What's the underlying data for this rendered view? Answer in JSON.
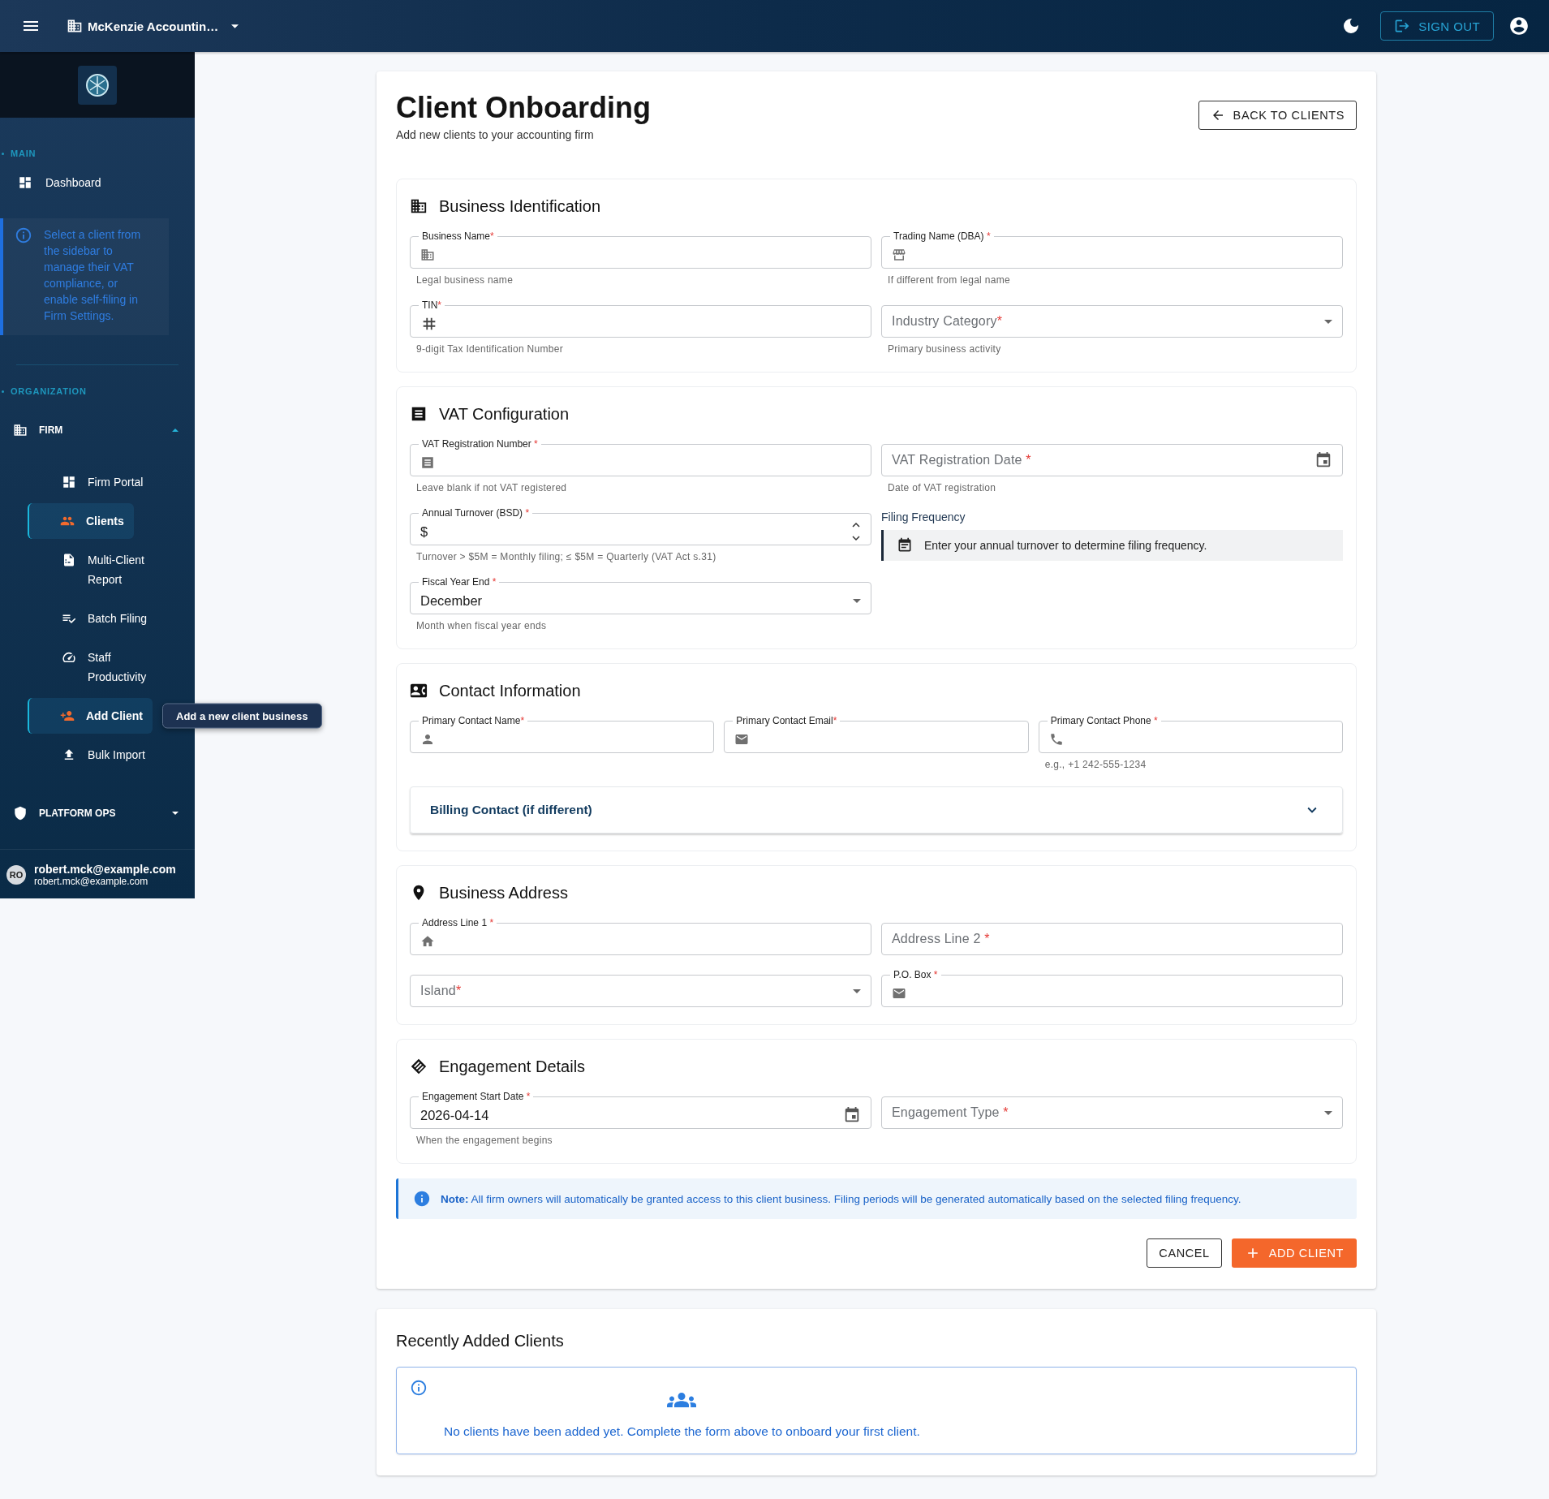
{
  "topbar": {
    "org_name": "McKenzie Accountin…",
    "sign_out": "SIGN OUT"
  },
  "sidebar": {
    "main_heading": "MAIN",
    "dashboard": "Dashboard",
    "notice": "Select a client from the sidebar to manage their VAT compliance, or enable self-filing in Firm Settings.",
    "org_heading": "ORGANIZATION",
    "groups": [
      {
        "label": "FIRM",
        "expanded": true,
        "children": [
          {
            "label": "Firm Portal",
            "selected": false
          },
          {
            "label": "Clients",
            "selected": true
          },
          {
            "label": "Multi-Client Report",
            "selected": false
          },
          {
            "label": "Batch Filing",
            "selected": false
          },
          {
            "label": "Staff Productivity",
            "selected": false
          },
          {
            "label": "Add Client",
            "selected": true,
            "tooltip": "Add a new client business"
          },
          {
            "label": "Bulk Import",
            "selected": false
          }
        ]
      },
      {
        "label": "PLATFORM OPS",
        "expanded": false
      }
    ],
    "user": {
      "initials": "RO",
      "name": "robert.mck@example.com",
      "email": "robert.mck@example.com"
    }
  },
  "page": {
    "title": "Client Onboarding",
    "subtitle": "Add new clients to your accounting firm",
    "back_button": "BACK TO CLIENTS"
  },
  "sections": [
    {
      "title": "Business Identification",
      "rows": [
        [
          {
            "kind": "text",
            "label": "Business Name",
            "mark": "*",
            "floated": true,
            "helper": "Legal business name"
          },
          {
            "kind": "text",
            "label": "Trading Name (DBA)",
            "mark": " *",
            "floated": true,
            "helper": "If different from legal name"
          }
        ],
        [
          {
            "kind": "text",
            "label": "TIN",
            "mark": "*",
            "floated": true,
            "helper": "9-digit Tax Identification Number"
          },
          {
            "kind": "select",
            "label": "Industry Category",
            "mark": "*",
            "floated": false,
            "helper": "Primary business activity"
          }
        ]
      ]
    },
    {
      "title": "VAT Configuration",
      "rows": [
        [
          {
            "kind": "text",
            "label": "VAT Registration Number",
            "mark": " *",
            "floated": true,
            "helper": "Leave blank if not VAT registered"
          },
          {
            "kind": "date",
            "label": "VAT Registration Date",
            "mark": " *",
            "floated": false,
            "helper": "Date of VAT registration"
          }
        ],
        [
          {
            "kind": "number",
            "label": "Annual Turnover (BSD)",
            "mark": " *",
            "floated": true,
            "prefix": "$",
            "helper": "Turnover > $5M = Monthly filing; ≤ $5M = Quarterly (VAT Act s.31)"
          },
          {
            "kind": "info",
            "label": "Filing Frequency",
            "text": "Enter your annual turnover to determine filing frequency."
          }
        ],
        [
          {
            "kind": "select",
            "label": "Fiscal Year End",
            "mark": " *",
            "floated": true,
            "value": "December",
            "helper": "Month when fiscal year ends"
          }
        ]
      ]
    },
    {
      "title": "Contact Information",
      "rows": [
        [
          {
            "kind": "text",
            "label": "Primary Contact Name",
            "mark": "*",
            "floated": true
          },
          {
            "kind": "text",
            "label": "Primary Contact Email",
            "mark": "*",
            "floated": true
          },
          {
            "kind": "text",
            "label": "Primary Contact Phone",
            "mark": " *",
            "floated": true,
            "helper": "e.g., +1 242-555-1234"
          }
        ]
      ],
      "accordion": {
        "title": "Billing Contact (if different)",
        "expanded": false
      }
    },
    {
      "title": "Business Address",
      "rows": [
        [
          {
            "kind": "text",
            "label": "Address Line 1",
            "mark": " *",
            "floated": true
          },
          {
            "kind": "text",
            "label": "Address Line 2",
            "mark": " *",
            "floated": false
          }
        ],
        [
          {
            "kind": "select",
            "label": "Island",
            "mark": "*",
            "floated": false
          },
          {
            "kind": "text",
            "label": "P.O. Box",
            "mark": " *",
            "floated": true
          }
        ]
      ]
    },
    {
      "title": "Engagement Details",
      "rows": [
        [
          {
            "kind": "date",
            "label": "Engagement Start Date",
            "mark": " *",
            "floated": true,
            "value": "2026-04-14",
            "helper": "When the engagement begins"
          },
          {
            "kind": "select",
            "label": "Engagement Type",
            "mark": " *",
            "floated": false
          }
        ]
      ]
    }
  ],
  "note": "**Note:** All firm owners will automatically be granted access to this client business. Filing periods will be generated automatically based on the selected filing frequency.",
  "actions": {
    "cancel": "CANCEL",
    "submit": "ADD CLIENT"
  },
  "recent": {
    "title": "Recently Added Clients",
    "empty_message": "No clients have been added yet. Complete the form above to onboard your first client."
  }
}
